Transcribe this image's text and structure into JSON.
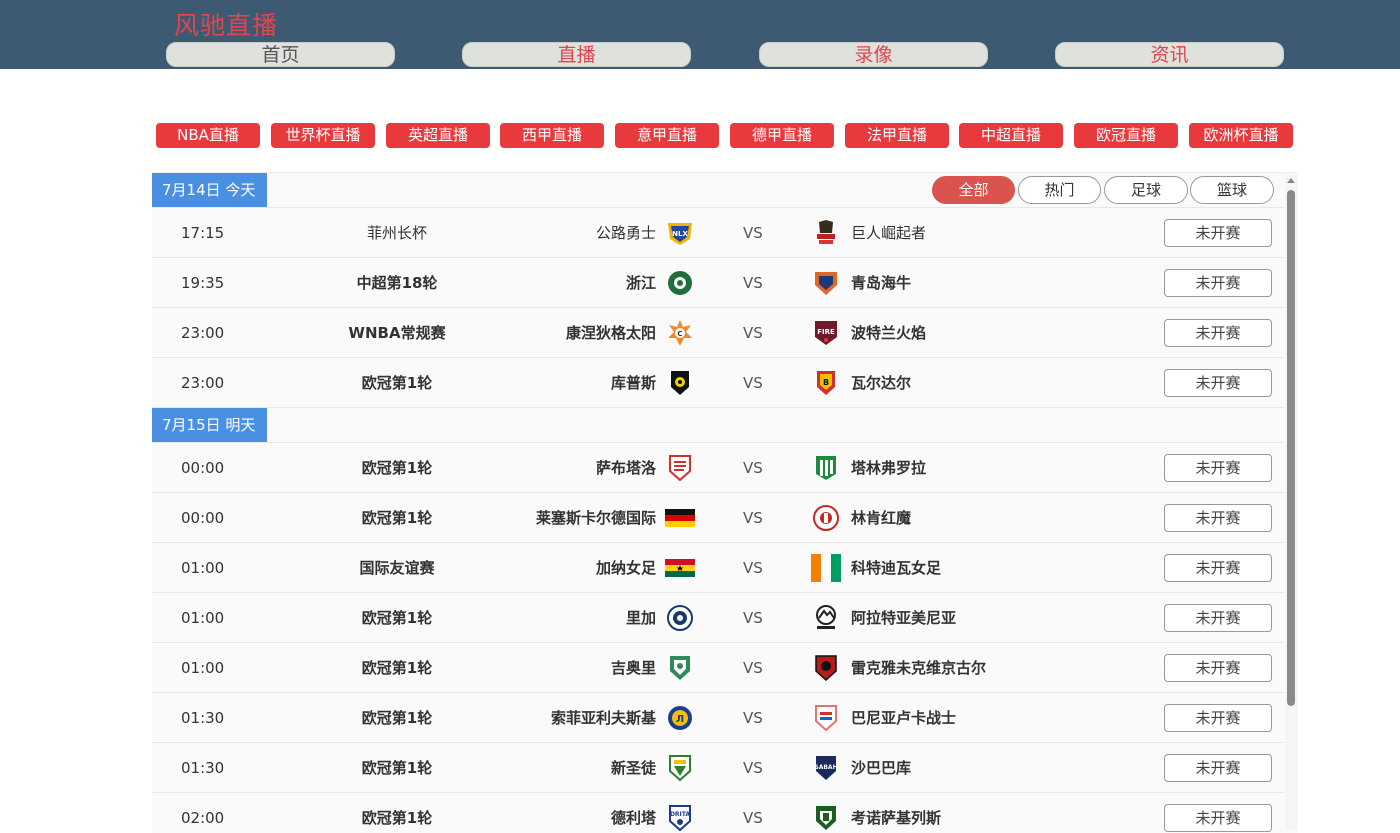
{
  "site": {
    "brand": "风驰直播"
  },
  "nav": [
    {
      "label": "首页",
      "highlight": false
    },
    {
      "label": "直播",
      "highlight": true
    },
    {
      "label": "录像",
      "highlight": true
    },
    {
      "label": "资讯",
      "highlight": true
    }
  ],
  "categories": [
    "NBA直播",
    "世界杯直播",
    "英超直播",
    "西甲直播",
    "意甲直播",
    "德甲直播",
    "法甲直播",
    "中超直播",
    "欧冠直播",
    "欧洲杯直播"
  ],
  "filters": [
    {
      "label": "全部",
      "active": true
    },
    {
      "label": "热门",
      "active": false
    },
    {
      "label": "足球",
      "active": false
    },
    {
      "label": "篮球",
      "active": false
    }
  ],
  "days": [
    {
      "date": "7月14日 今天",
      "matches": [
        {
          "time": "17:15",
          "league": "菲州长杯",
          "home": "公路勇士",
          "away": "巨人崛起者",
          "vs": "VS",
          "status": "未开赛"
        },
        {
          "time": "19:35",
          "league": "中超第18轮",
          "home": "浙江",
          "away": "青岛海牛",
          "vs": "VS",
          "status": "未开赛"
        },
        {
          "time": "23:00",
          "league": "WNBA常规赛",
          "home": "康涅狄格太阳",
          "away": "波特兰火焰",
          "vs": "VS",
          "status": "未开赛"
        },
        {
          "time": "23:00",
          "league": "欧冠第1轮",
          "home": "库普斯",
          "away": "瓦尔达尔",
          "vs": "VS",
          "status": "未开赛"
        }
      ]
    },
    {
      "date": "7月15日 明天",
      "matches": [
        {
          "time": "00:00",
          "league": "欧冠第1轮",
          "home": "萨布塔洛",
          "away": "塔林弗罗拉",
          "vs": "VS",
          "status": "未开赛"
        },
        {
          "time": "00:00",
          "league": "欧冠第1轮",
          "home": "莱塞斯卡尔德国际",
          "away": "林肯红魔",
          "vs": "VS",
          "status": "未开赛"
        },
        {
          "time": "01:00",
          "league": "国际友谊赛",
          "home": "加纳女足",
          "away": "科特迪瓦女足",
          "vs": "VS",
          "status": "未开赛"
        },
        {
          "time": "01:00",
          "league": "欧冠第1轮",
          "home": "里加",
          "away": "阿拉特亚美尼亚",
          "vs": "VS",
          "status": "未开赛"
        },
        {
          "time": "01:00",
          "league": "欧冠第1轮",
          "home": "吉奥里",
          "away": "雷克雅未克维京古尔",
          "vs": "VS",
          "status": "未开赛"
        },
        {
          "time": "01:30",
          "league": "欧冠第1轮",
          "home": "索菲亚利夫斯基",
          "away": "巴尼亚卢卡战士",
          "vs": "VS",
          "status": "未开赛"
        },
        {
          "time": "01:30",
          "league": "欧冠第1轮",
          "home": "新圣徒",
          "away": "沙巴巴库",
          "vs": "VS",
          "status": "未开赛"
        },
        {
          "time": "02:00",
          "league": "欧冠第1轮",
          "home": "德利塔",
          "away": "考诺萨基列斯",
          "vs": "VS",
          "status": "未开赛"
        }
      ]
    }
  ],
  "logos": {
    "row0_home": "nlex-road-warriors-logo",
    "row0_away": "titan-logo",
    "row1_home": "zhejiang-logo",
    "row1_away": "qingdao-hainiu-logo",
    "row2_home": "connecticut-sun-logo",
    "row2_away": "portland-fire-logo",
    "row3_home": "kups-logo",
    "row3_away": "vardar-logo",
    "row4_home": "saburtalo-logo",
    "row4_away": "flora-tallinn-logo",
    "row5_home": "germany-flag",
    "row5_away": "lincoln-red-imps-logo",
    "row6_home": "ghana-flag",
    "row6_away": "ivory-coast-flag",
    "row7_home": "riga-logo",
    "row7_away": "ararat-logo",
    "row8_home": "gyori-logo",
    "row8_away": "vikingur-logo",
    "row9_home": "levski-sofia-logo",
    "row9_away": "borac-banja-luka-logo",
    "row10_home": "the-new-saints-logo",
    "row10_away": "sabah-logo",
    "row11_home": "drita-logo",
    "row11_away": "zalgiris-logo"
  }
}
